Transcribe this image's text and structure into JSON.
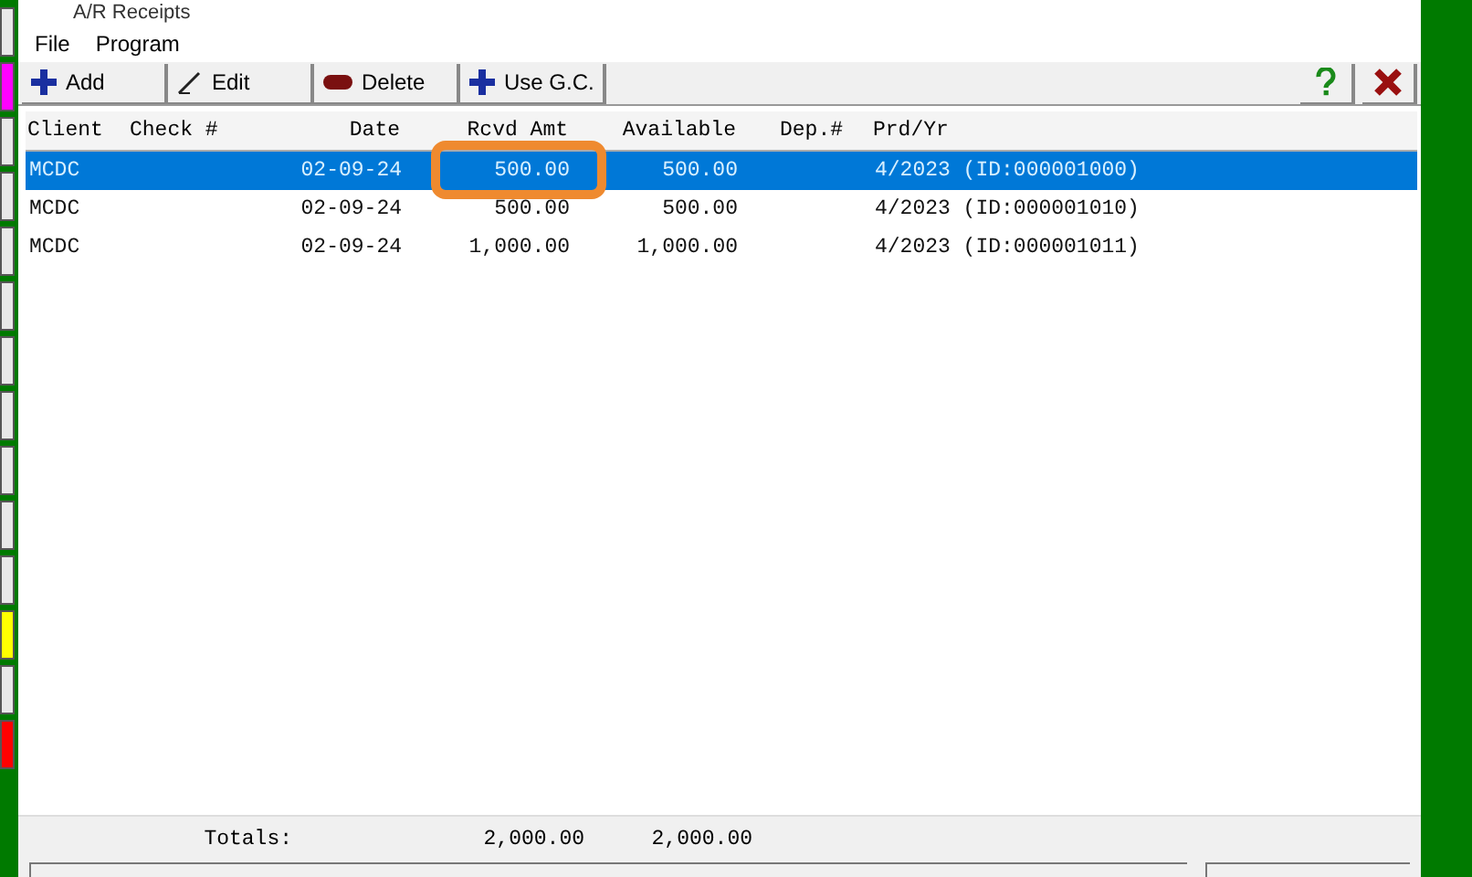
{
  "window": {
    "title": "A/R Receipts"
  },
  "menu": [
    "File",
    "Program"
  ],
  "toolbar": [
    {
      "kind": "add",
      "label": "Add"
    },
    {
      "kind": "edit",
      "label": "Edit"
    },
    {
      "kind": "delete",
      "label": "Delete"
    },
    {
      "kind": "add",
      "label": "Use G.C."
    }
  ],
  "table": {
    "columns": [
      "Client",
      "Check #",
      "Date",
      "Rcvd Amt",
      "Available",
      "Dep.#",
      "Prd/Yr"
    ],
    "rows": [
      {
        "selected": true,
        "highlighted": true,
        "cells": [
          "MCDC",
          "",
          "02-09-24",
          "500.00",
          "500.00",
          "",
          "4/2023 (ID:000001000)"
        ]
      },
      {
        "selected": false,
        "highlighted": false,
        "cells": [
          "MCDC",
          "",
          "02-09-24",
          "500.00",
          "500.00",
          "",
          "4/2023 (ID:000001010)"
        ]
      },
      {
        "selected": false,
        "highlighted": false,
        "cells": [
          "MCDC",
          "",
          "02-09-24",
          "1,000.00",
          "1,000.00",
          "",
          "4/2023 (ID:000001011)"
        ]
      }
    ]
  },
  "totals": {
    "label": "Totals:",
    "rcvd": "2,000.00",
    "available": "2,000.00"
  },
  "side_tabs": [
    {
      "color": "#e8e8e8"
    },
    {
      "color": "#ff00ff"
    },
    {
      "color": "#e8e8e8"
    },
    {
      "color": "#e8e8e8"
    },
    {
      "color": "#e8e8e8"
    },
    {
      "color": "#e8e8e8"
    },
    {
      "color": "#e8e8e8"
    },
    {
      "color": "#e8e8e8"
    },
    {
      "color": "#e8e8e8"
    },
    {
      "color": "#e8e8e8"
    },
    {
      "color": "#e8e8e8"
    },
    {
      "color": "#ffff00"
    },
    {
      "color": "#e8e8e8"
    },
    {
      "color": "#ff0000"
    }
  ]
}
